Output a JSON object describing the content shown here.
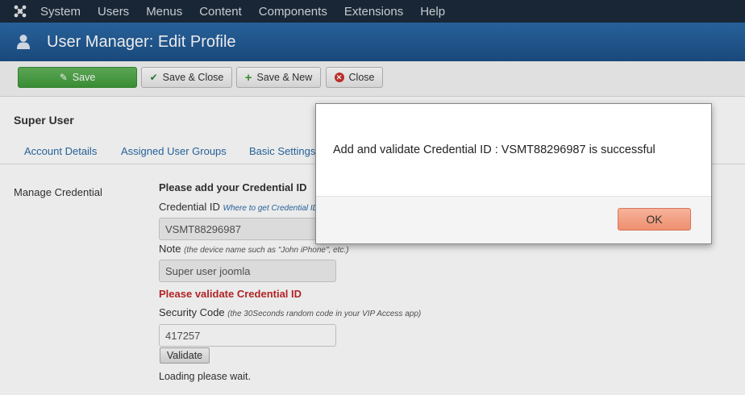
{
  "menu": {
    "items": [
      "System",
      "Users",
      "Menus",
      "Content",
      "Components",
      "Extensions",
      "Help"
    ]
  },
  "header": {
    "title": "User Manager: Edit Profile"
  },
  "toolbar": {
    "save_label": "Save",
    "save_close_label": "Save & Close",
    "save_new_label": "Save & New",
    "close_label": "Close"
  },
  "page": {
    "section_title": "Super User",
    "tabs": [
      "Account Details",
      "Assigned User Groups",
      "Basic Settings"
    ]
  },
  "credential": {
    "field_label": "Manage Credential",
    "heading": "Please add your Credential ID",
    "id_label": "Credential ID",
    "id_link": "Where to get Credential ID",
    "id_value": "VSMT88296987",
    "note_label": "Note",
    "note_hint": "(the device name such as \"John iPhone\", etc.)",
    "note_value": "Super user joomla",
    "warning": "Please validate Credential ID",
    "security_label": "Security Code",
    "security_hint": "(the 30Seconds random code in your VIP Access app)",
    "security_value": "417257",
    "validate_label": "Validate",
    "loading_text": "Loading please wait."
  },
  "dialog": {
    "message": "Add and validate Credential ID : VSMT88296987 is successful",
    "ok_label": "OK"
  },
  "colors": {
    "topbar": "#1b2a3a",
    "titlebar": "#2b6aa7",
    "save_button": "#4ca646",
    "link": "#2a6aa5",
    "warning": "#c0282a",
    "ok_button": "#f2a083"
  }
}
